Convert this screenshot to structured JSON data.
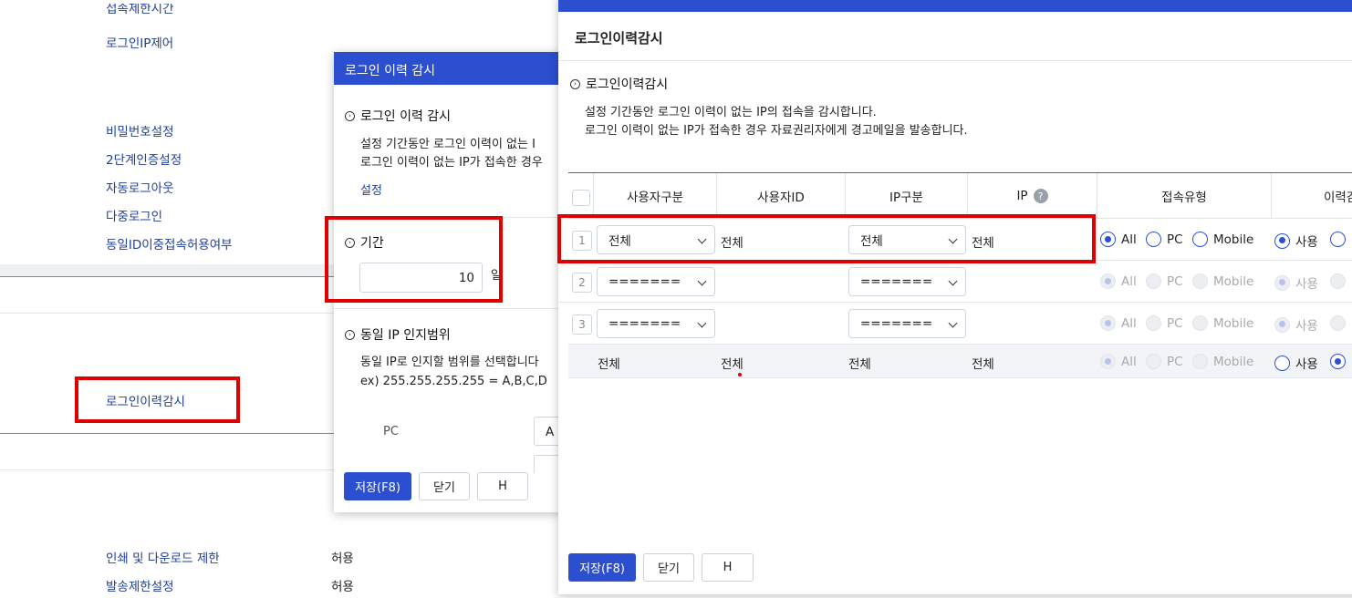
{
  "background": {
    "cut_item": "접속제한시간",
    "items": [
      {
        "label": "로그인IP제어"
      },
      {
        "label": "비밀번호설정"
      },
      {
        "label": "2단계인증설정"
      },
      {
        "label": "자동로그아웃"
      },
      {
        "label": "다중로그인"
      },
      {
        "label": "동일ID이중접속허용여부"
      },
      {
        "label": "로그인이력감시"
      },
      {
        "label": "인쇄 및 다운로드 제한"
      },
      {
        "label": "발송제한설정"
      }
    ],
    "values": {
      "print_download": "허용",
      "send_limit": "허용"
    }
  },
  "dialog_small": {
    "title": "로그인 이력 감시",
    "section1_title": "로그인 이력 감시",
    "desc_line1": "설정 기간동안 로그인 이력이 없는 I",
    "desc_line2": "로그인 이력이 없는 IP가 접속한 경우",
    "settings_link": "설정",
    "period_title": "기간",
    "period_value": "10",
    "period_unit": "일",
    "section3_title": "동일 IP 인지범위",
    "range_desc1": "동일 IP로 인지할 범위를 선택합니다",
    "range_desc2": "ex) 255.255.255.255 = A,B,C,D",
    "pc_label": "PC",
    "pc_select_value": "A",
    "save_btn": "저장(F8)",
    "close_btn": "닫기",
    "h_btn": "H"
  },
  "dialog_large": {
    "page_title": "로그인이력감시",
    "section_title": "로그인이력감시",
    "desc_line1": "설정 기간동안 로그인 이력이 없는 IP의 접속을 감시합니다.",
    "desc_line2": "로그인 이력이 없는 IP가 접속한 경우 자료권리자에게 경고메일을 발송합니다.",
    "columns": {
      "user_type": "사용자구분",
      "user_id": "사용자ID",
      "ip_type": "IP구분",
      "ip": "IP",
      "ip_help": "?",
      "conn_type": "접속유형",
      "history": "이력감"
    },
    "rows": [
      {
        "num": "1",
        "user_type": "전체",
        "user_id": "전체",
        "ip_type": "전체",
        "ip": "전체"
      },
      {
        "num": "2",
        "user_type": "=======",
        "ip_type": "======="
      },
      {
        "num": "3",
        "user_type": "=======",
        "ip_type": "======="
      }
    ],
    "summary": {
      "user_type": "전체",
      "user_id": "전체",
      "ip_type": "전체",
      "ip": "전체"
    },
    "radio_labels": {
      "all": "All",
      "pc": "PC",
      "mobile": "Mobile",
      "use": "사용"
    },
    "save_btn": "저장(F8)",
    "close_btn": "닫기",
    "h_btn": "H"
  },
  "colors": {
    "accent": "#2c4fd0",
    "highlight": "#e00000",
    "link": "#1f3f99"
  }
}
